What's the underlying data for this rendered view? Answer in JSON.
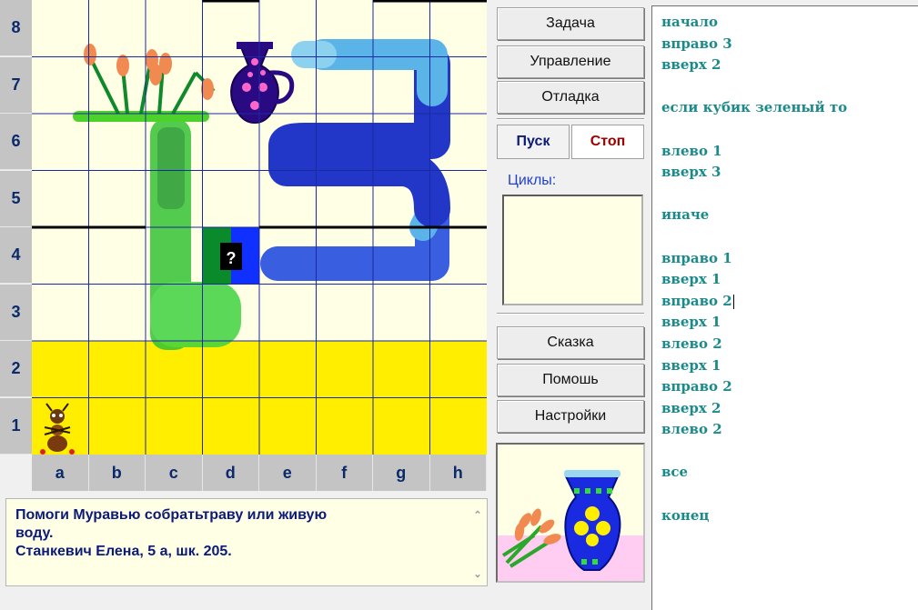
{
  "board": {
    "rows": [
      "8",
      "7",
      "6",
      "5",
      "4",
      "3",
      "2",
      "1"
    ],
    "cols": [
      "a",
      "b",
      "c",
      "d",
      "e",
      "f",
      "g",
      "h"
    ],
    "cell_marker": "?",
    "character": "ant-icon",
    "items": [
      "vase-icon",
      "reeds-icon"
    ]
  },
  "description": {
    "lines": [
      "Помоги Муравью собратьтраву или живую",
      "воду.",
      "Станкевич  Елена, 5 а, шк. 205."
    ]
  },
  "menu": {
    "task": "Задача",
    "control": "Управление",
    "debug": "Отладка",
    "run": "Пуск",
    "stop": "Стоп",
    "cycles_label": "Циклы:",
    "story": "Сказка",
    "help": "Помошь",
    "settings": "Настройки"
  },
  "program": {
    "lines": [
      "начало",
      "вправо 3",
      "вверх 2",
      "",
      "если кубик зеленый то",
      "",
      "влево 1",
      "вверх 3",
      "",
      "иначе",
      "",
      "вправо 1",
      "вверх 1",
      "вправо 2",
      "вверх 1",
      "влево 2",
      "вверх 1",
      "вправо 2",
      "вверх 2",
      "влево 2",
      "",
      "все",
      "",
      "конец"
    ]
  },
  "colors": {
    "grid_bg": "#ffffe6",
    "grid_lines": "#1a2aa0",
    "yellow_rows": "#ffee00",
    "green_path": "#3fcf3f",
    "blue_path": "#1a2ad0",
    "text_navy": "#0c1a78",
    "program_text": "#1a8a8a"
  }
}
